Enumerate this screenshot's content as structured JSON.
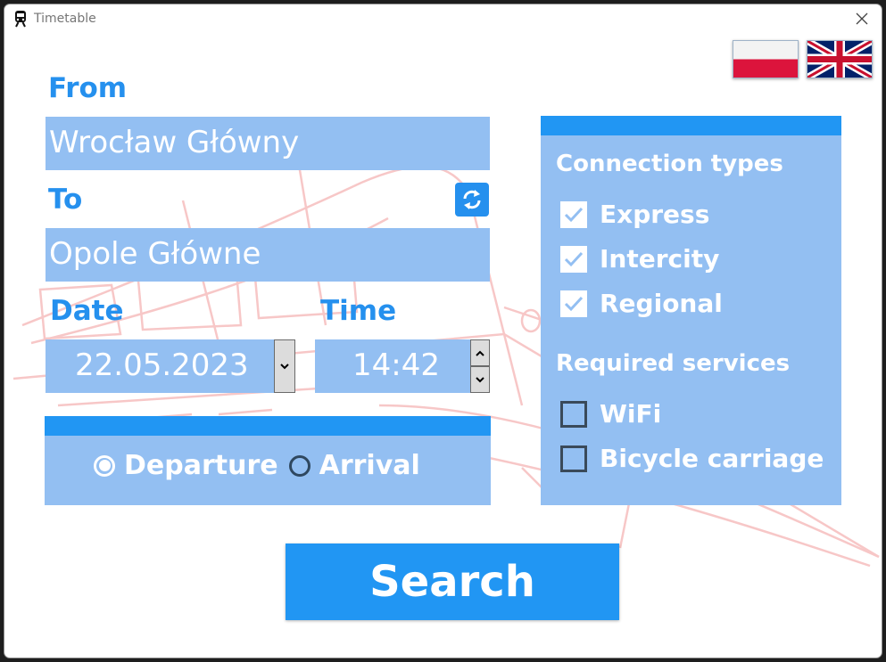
{
  "window": {
    "title": "Timetable",
    "icon": "train-icon",
    "close_icon": "close-icon"
  },
  "flags": [
    {
      "name": "polish-flag",
      "icon": "flag-pl-icon"
    },
    {
      "name": "english-flag",
      "icon": "flag-uk-icon"
    }
  ],
  "from": {
    "label": "From",
    "value": "Wrocław Główny"
  },
  "to": {
    "label": "To",
    "value": "Opole Główne",
    "swap_icon": "swap-icon"
  },
  "date": {
    "label": "Date",
    "value": "22.05.2023",
    "dropdown_icon": "chevron-down-icon"
  },
  "time": {
    "label": "Time",
    "value": "14:42",
    "up_icon": "chevron-up-icon",
    "down_icon": "chevron-down-icon"
  },
  "mode": {
    "selected": "Departure",
    "departure_label": "Departure",
    "arrival_label": "Arrival"
  },
  "connection_types": {
    "title": "Connection types",
    "items": [
      {
        "label": "Express",
        "checked": true
      },
      {
        "label": "Intercity",
        "checked": true
      },
      {
        "label": "Regional",
        "checked": true
      }
    ]
  },
  "required_services": {
    "title": "Required services",
    "items": [
      {
        "label": "WiFi",
        "checked": false
      },
      {
        "label": "Bicycle carriage",
        "checked": false
      }
    ]
  },
  "search": {
    "label": "Search"
  },
  "colors": {
    "accent": "#2196f3",
    "label_blue": "#2590ee",
    "field_fill": "#93bff2",
    "text_white": "#ffffff",
    "flag_red": "#dc143c",
    "uk_blue": "#012169",
    "uk_red": "#c8102e"
  }
}
